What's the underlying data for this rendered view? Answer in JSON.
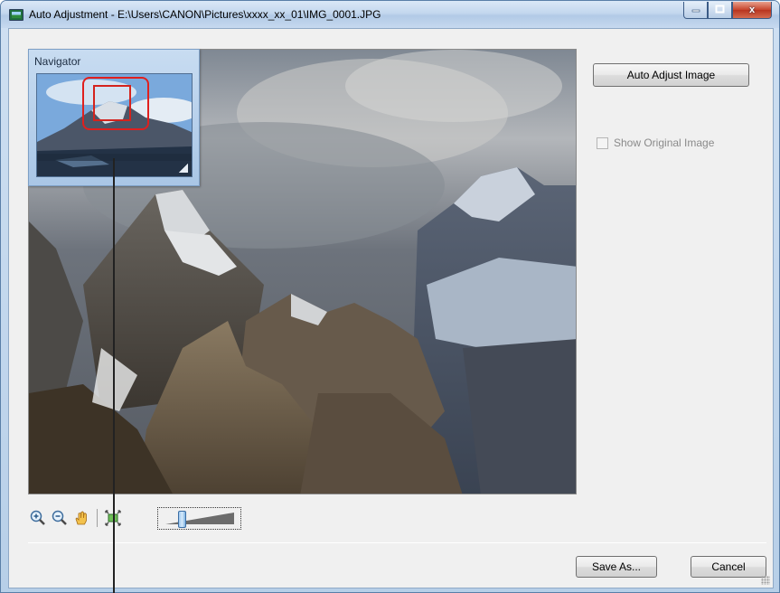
{
  "window": {
    "title": "Auto Adjustment - E:\\Users\\CANON\\Pictures\\xxxx_xx_01\\IMG_0001.JPG",
    "minimize_icon": "minimize-icon",
    "maximize_icon": "maximize-icon",
    "close_label": "x"
  },
  "navigator": {
    "title": "Navigator"
  },
  "panel": {
    "auto_adjust_label": "Auto Adjust Image",
    "show_original_label": "Show Original Image",
    "show_original_checked": false,
    "show_original_enabled": false
  },
  "toolbar": {
    "icons": [
      "zoom-in-icon",
      "zoom-out-icon",
      "hand-icon",
      "fit-to-window-icon"
    ],
    "zoom_slider_fraction": 0.2
  },
  "footer": {
    "save_as_label": "Save As...",
    "cancel_label": "Cancel"
  },
  "colors": {
    "highlight": "#e0201e",
    "title_bar": "#c3d7ee",
    "close_button": "#c7432b"
  }
}
